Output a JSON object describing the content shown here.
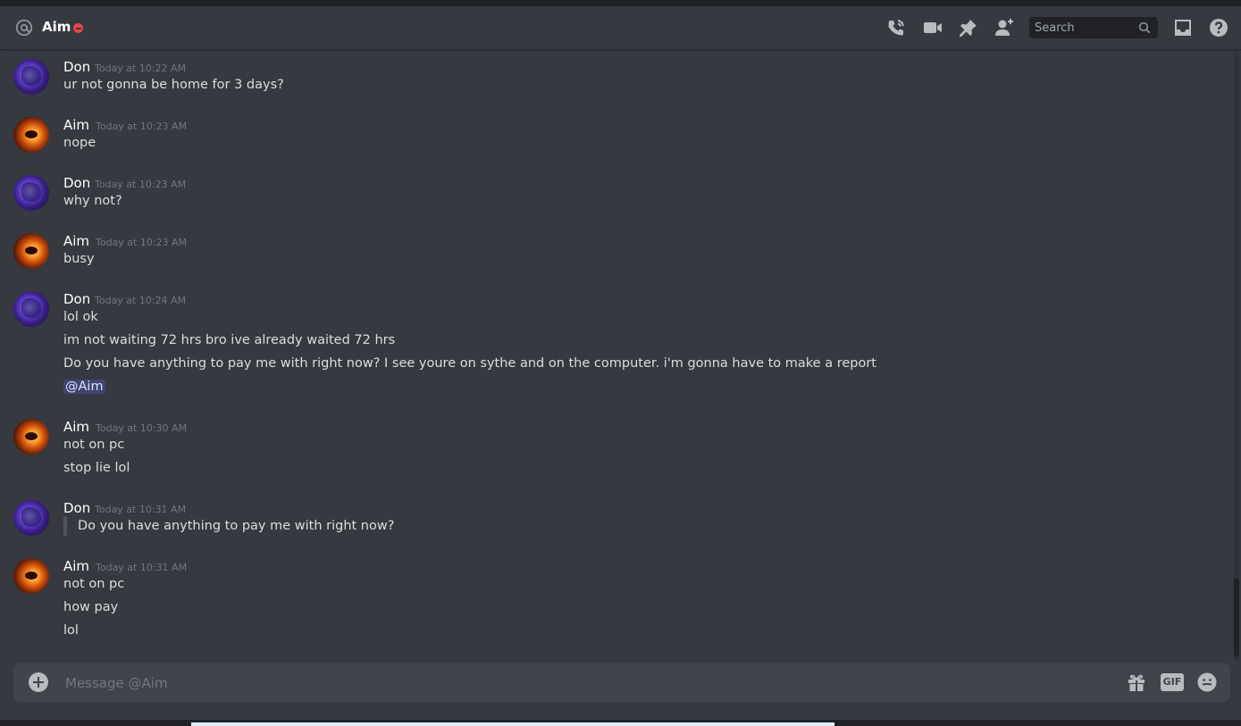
{
  "header": {
    "title": "Aim",
    "search_placeholder": "Search"
  },
  "messages": [
    {
      "author": "Don",
      "timestamp": "Today at 10:22 AM",
      "lines": [
        "ur not gonna be home for 3 days?"
      ]
    },
    {
      "author": "Aim",
      "timestamp": "Today at 10:23 AM",
      "lines": [
        "nope"
      ]
    },
    {
      "author": "Don",
      "timestamp": "Today at 10:23 AM",
      "lines": [
        "why not?"
      ]
    },
    {
      "author": "Aim",
      "timestamp": "Today at 10:23 AM",
      "lines": [
        "busy"
      ]
    },
    {
      "author": "Don",
      "timestamp": "Today at 10:24 AM",
      "lines": [
        "lol ok",
        "im not waiting 72 hrs bro ive already waited 72 hrs",
        "Do you have anything to pay me with right now? I see youre on sythe and on the computer. i'm gonna have to make a report"
      ],
      "mention": "@Aim"
    },
    {
      "author": "Aim",
      "timestamp": "Today at 10:30 AM",
      "lines": [
        "not on pc",
        "stop lie lol"
      ]
    },
    {
      "author": "Don",
      "timestamp": "Today at 10:31 AM",
      "quote": "Do you have anything to pay me with right now?"
    },
    {
      "author": "Aim",
      "timestamp": "Today at 10:31 AM",
      "lines": [
        "not on pc",
        "how pay",
        "lol"
      ]
    }
  ],
  "composer": {
    "placeholder": "Message @Aim",
    "gif_label": "GIF"
  },
  "icons": {
    "header": [
      "at-icon",
      "phone-call-icon",
      "video-camera-icon",
      "pin-icon",
      "add-friend-icon",
      "search-icon",
      "inbox-icon",
      "help-icon"
    ],
    "composer": [
      "plus-circle-icon",
      "gift-icon",
      "emoji-icon"
    ]
  },
  "colors": {
    "background": "#36393f",
    "composer": "#40444b",
    "dnd_status": "#ed4245",
    "mention": "#5865f2",
    "timestamp": "#72767d"
  }
}
